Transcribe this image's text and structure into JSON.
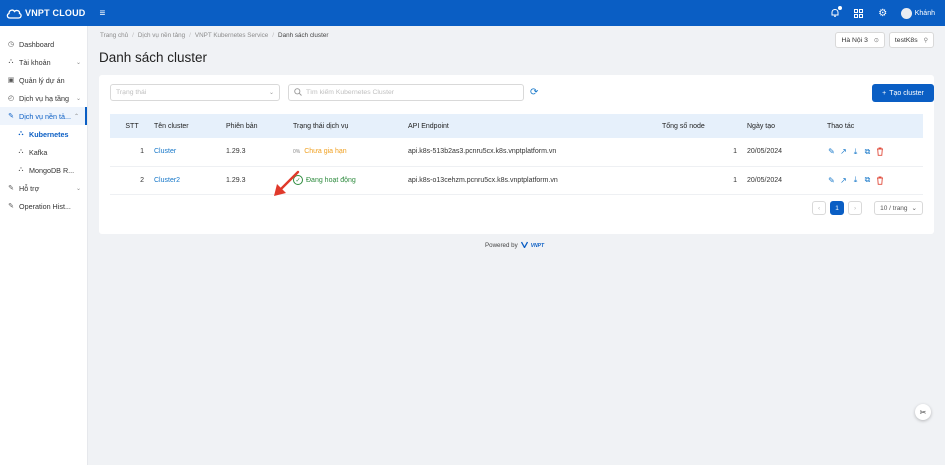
{
  "topbar": {
    "brand": "VNPT CLOUD",
    "menu_icon": "hamburger-icon",
    "user_name": "Khánh"
  },
  "sidebar": {
    "items": [
      {
        "label": "Dashboard",
        "icon": "clock-icon"
      },
      {
        "label": "Tài khoản",
        "icon": "user-icon",
        "chevron": "⌄"
      },
      {
        "label": "Quản lý dự án",
        "icon": "folder-icon"
      },
      {
        "label": "Dịch vụ hạ tầng",
        "icon": "server-icon",
        "chevron": "⌄"
      },
      {
        "label": "Dịch vụ nền tả...",
        "icon": "platform-icon",
        "chevron": "⌃"
      },
      {
        "label": "Kubernetes",
        "icon": "user-icon"
      },
      {
        "label": "Kafka",
        "icon": "user-icon"
      },
      {
        "label": "MongoDB R...",
        "icon": "user-icon"
      },
      {
        "label": "Hỗ trợ",
        "icon": "support-icon",
        "chevron": "⌄"
      },
      {
        "label": "Operation Hist...",
        "icon": "history-icon"
      }
    ]
  },
  "breadcrumb": [
    "Trang chủ",
    "Dịch vụ nền tảng",
    "VNPT Kubernetes Service",
    "Danh sách cluster"
  ],
  "page_title": "Danh sách cluster",
  "region_select": "Hà Nội 3",
  "project_select": "testK8s",
  "filters": {
    "status_placeholder": "Trạng thái",
    "search_placeholder": "Tìm kiếm Kubernetes Cluster"
  },
  "create_button": "Tạo cluster",
  "table": {
    "headers": [
      "STT",
      "Tên cluster",
      "Phiên bản",
      "Trạng thái dịch vụ",
      "API Endpoint",
      "Tổng số node",
      "Ngày tạo",
      "Thao tác"
    ],
    "rows": [
      {
        "stt": "1",
        "name": "Cluster",
        "version": "1.29.3",
        "status": "Chưa gia hạn",
        "status_prefix": "0%",
        "endpoint": "api.k8s-513b2as3.pcnru5cx.k8s.vnptplatform.vn",
        "nodes": "1",
        "created": "20/05/2024"
      },
      {
        "stt": "2",
        "name": "Cluster2",
        "version": "1.29.3",
        "status": "Đang hoạt động",
        "endpoint": "api.k8s-o13cehzm.pcnru5cx.k8s.vnptplatform.vn",
        "nodes": "1",
        "created": "20/05/2024"
      }
    ]
  },
  "pagination": {
    "current_page": "1",
    "prev": "‹",
    "next": "›",
    "page_size": "10 / trang"
  },
  "footer": {
    "powered_by": "Powered by",
    "brand": "VNPT"
  },
  "colors": {
    "primary": "#0a5ec4",
    "warning": "#f0a020",
    "success": "#2e8b3e",
    "danger": "#e04a3a",
    "annotation_arrow": "#e0392b"
  }
}
